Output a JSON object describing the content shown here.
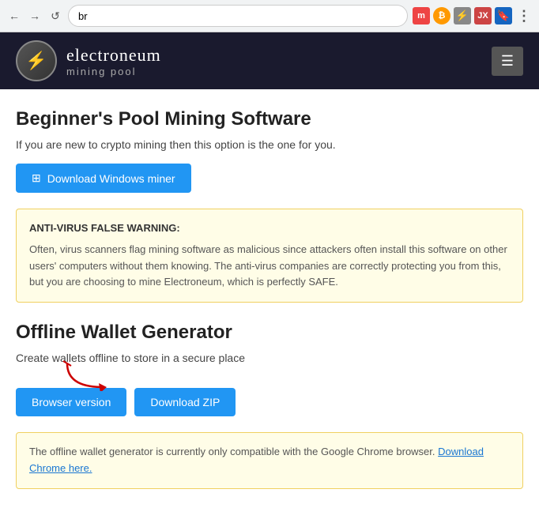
{
  "browser": {
    "address_value": "br",
    "nav_back_label": "←",
    "nav_forward_label": "→",
    "nav_refresh_label": "↺",
    "menu_label": "⋮",
    "icons": [
      {
        "name": "m-icon",
        "label": "m",
        "style": "icon-m"
      },
      {
        "name": "btc-icon",
        "label": "₿",
        "style": "icon-btc"
      },
      {
        "name": "bolt-icon",
        "label": "⚡",
        "style": "icon-bolt"
      },
      {
        "name": "jx-icon",
        "label": "JX",
        "style": "icon-jx"
      },
      {
        "name": "bookmark-icon",
        "label": "🔖",
        "style": "icon-bk"
      }
    ]
  },
  "header": {
    "logo_symbol": "⚡",
    "logo_name": "electroneum",
    "logo_sub": "mining pool",
    "hamburger_label": "☰"
  },
  "section1": {
    "title": "Beginner's Pool Mining Software",
    "desc": "If you are new to crypto mining then this option is the one for you.",
    "download_btn": "Download  Windows miner"
  },
  "warning": {
    "title": "ANTI-VIRUS FALSE WARNING:",
    "body": "Often, virus scanners flag mining software as malicious since attackers often install this software on other users' computers without them knowing. The anti-virus companies are correctly protecting you from this, but you are choosing to mine Electroneum, which is perfectly SAFE."
  },
  "section2": {
    "title": "Offline Wallet Generator",
    "desc": "Create wallets offline to store in a secure place",
    "browser_btn": "Browser version",
    "download_btn": "Download ZIP"
  },
  "info": {
    "text": "The offline wallet generator is currently only compatible with the Google Chrome browser.",
    "link_text": "Download Chrome here."
  }
}
